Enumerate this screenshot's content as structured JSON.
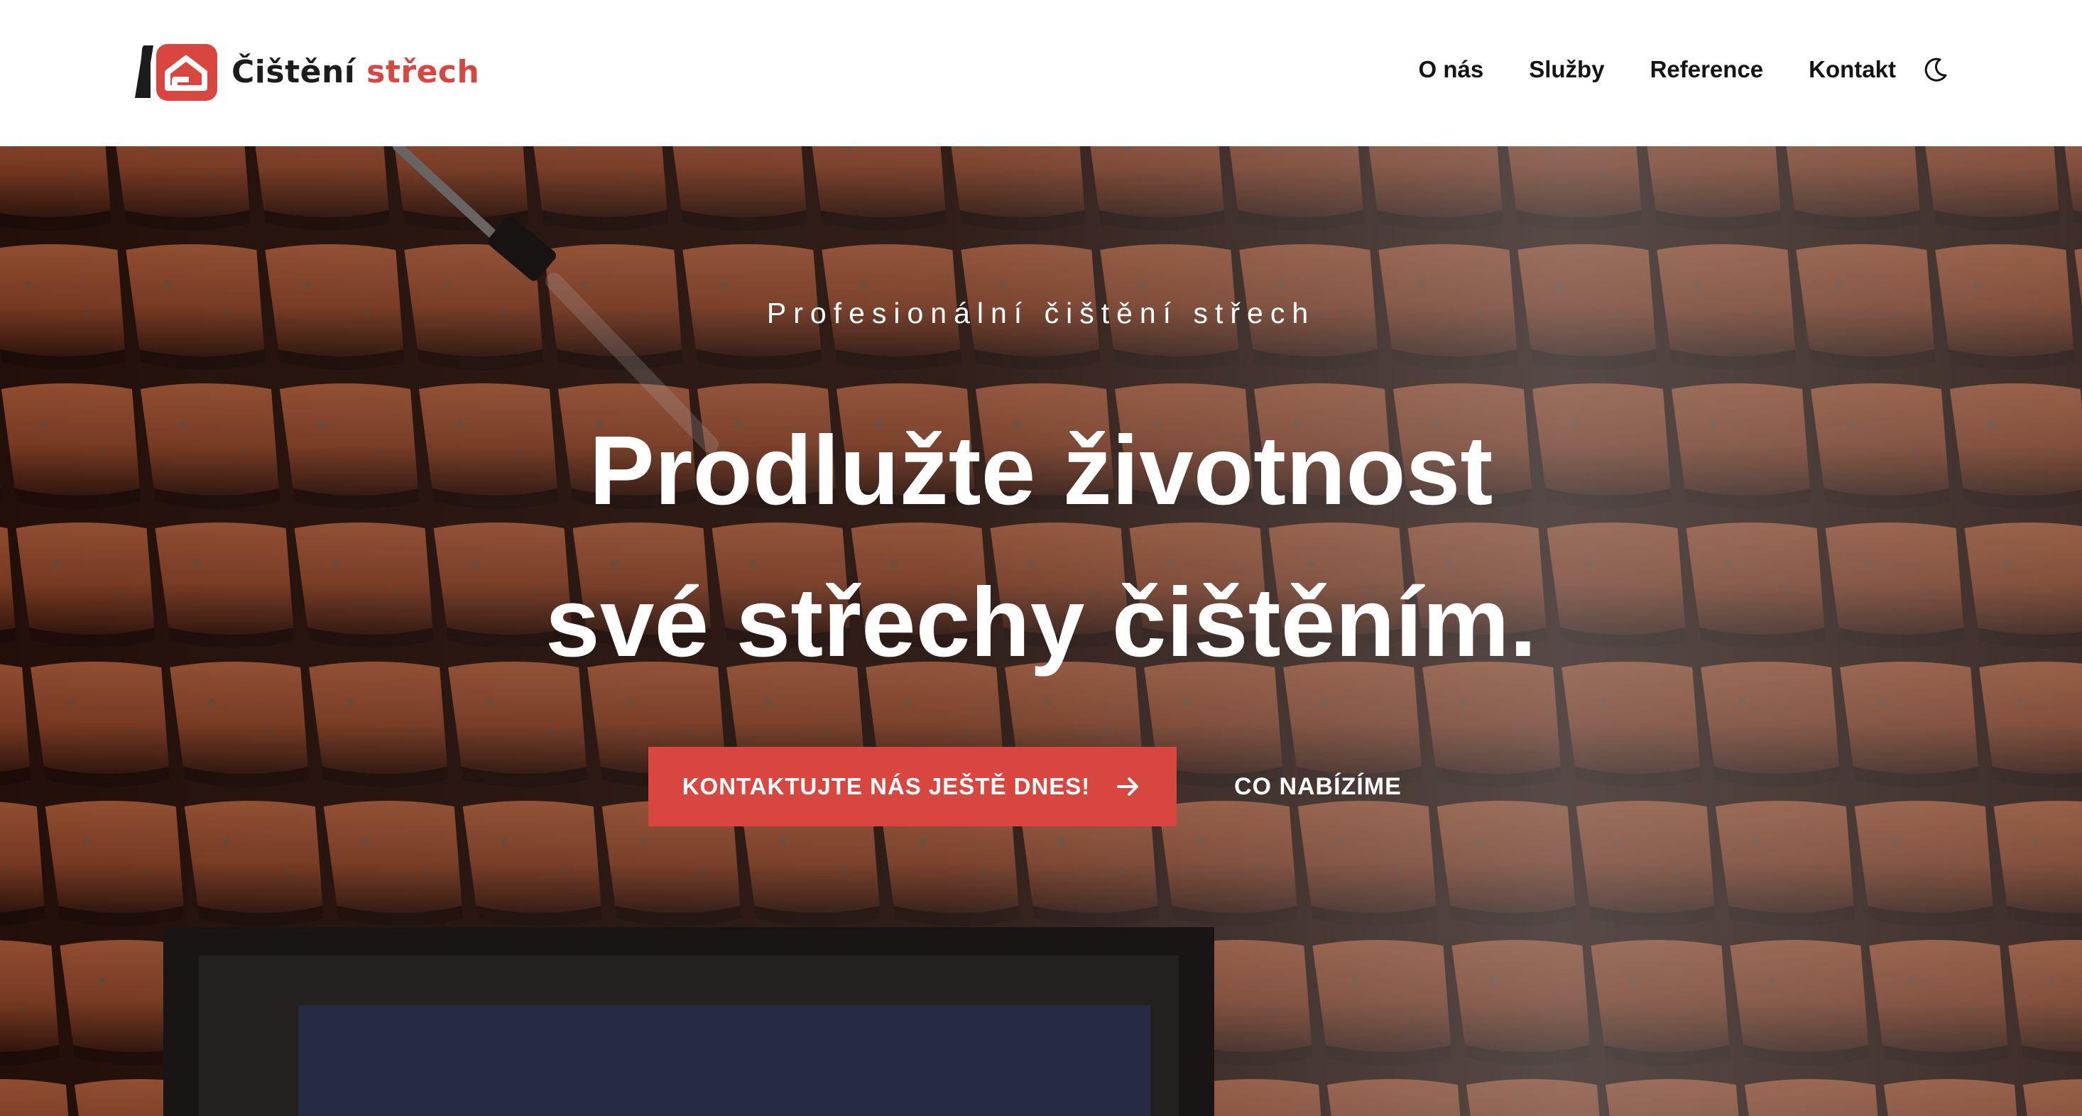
{
  "brand": {
    "name_part1": "Čištění",
    "name_part2": "střech",
    "accent_color": "#d8463f",
    "logo_icon": "house-roof-logo-icon"
  },
  "nav": {
    "items": [
      {
        "label": "O nás"
      },
      {
        "label": "Služby"
      },
      {
        "label": "Reference"
      },
      {
        "label": "Kontakt"
      }
    ],
    "theme_toggle_icon": "moon-icon"
  },
  "hero": {
    "eyebrow": "Profesionální čištění střech",
    "headline_line1": "Prodlužte životnost",
    "headline_line2": "své střechy čištěním.",
    "primary_cta": "KONTAKTUJTE NÁS JEŠTĚ DNES!",
    "primary_cta_icon": "arrow-right-icon",
    "secondary_cta": "CO NABÍZÍME",
    "background_image": "roof-tiles-pressure-washing-photo"
  }
}
